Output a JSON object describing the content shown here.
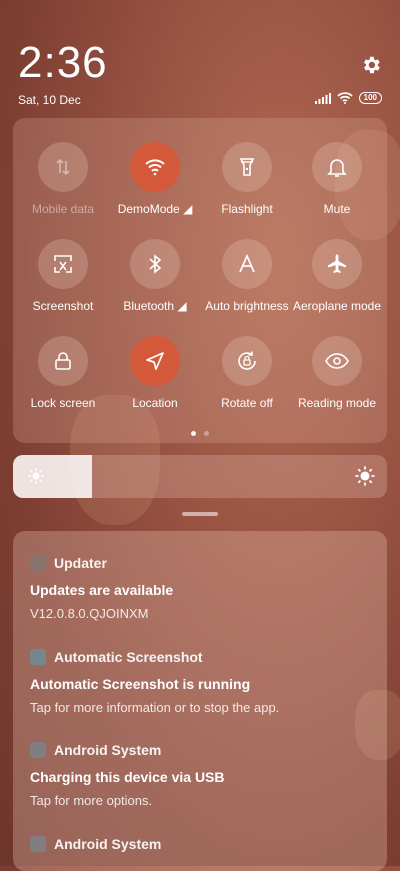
{
  "status": {
    "time": "2:36",
    "date": "Sat, 10 Dec",
    "battery": "100"
  },
  "tiles": [
    {
      "label": "Mobile data",
      "icon": "mobile-data-icon",
      "active": false,
      "dim": true
    },
    {
      "label": "DemoMode",
      "icon": "wifi-icon",
      "active": true,
      "dim": false
    },
    {
      "label": "Flashlight",
      "icon": "flashlight-icon",
      "active": false,
      "dim": false
    },
    {
      "label": "Mute",
      "icon": "bell-icon",
      "active": false,
      "dim": false
    },
    {
      "label": "Screenshot",
      "icon": "screenshot-icon",
      "active": false,
      "dim": false
    },
    {
      "label": "Bluetooth",
      "icon": "bluetooth-icon",
      "active": false,
      "dim": false
    },
    {
      "label": "Auto brightness",
      "icon": "auto-brightness-icon",
      "active": false,
      "dim": false
    },
    {
      "label": "Aeroplane mode",
      "icon": "airplane-icon",
      "active": false,
      "dim": false
    },
    {
      "label": "Lock screen",
      "icon": "lock-icon",
      "active": false,
      "dim": false
    },
    {
      "label": "Location",
      "icon": "location-icon",
      "active": true,
      "dim": false
    },
    {
      "label": "Rotate off",
      "icon": "rotate-lock-icon",
      "active": false,
      "dim": false
    },
    {
      "label": "Reading mode",
      "icon": "eye-icon",
      "active": false,
      "dim": false
    }
  ],
  "brightness": {
    "level": 0.21
  },
  "colors": {
    "active_tile": "#d4583a"
  },
  "notifications": [
    {
      "app": "Updater",
      "title": "Updates are available",
      "body": "V12.0.8.0.QJOINXM"
    },
    {
      "app": "Automatic Screenshot",
      "title": "Automatic Screenshot is running",
      "body": "Tap for more information or to stop the app."
    },
    {
      "app": "Android System",
      "title": "Charging this device via USB",
      "body": "Tap for more options."
    },
    {
      "app": "Android System",
      "title": "",
      "body": ""
    }
  ]
}
